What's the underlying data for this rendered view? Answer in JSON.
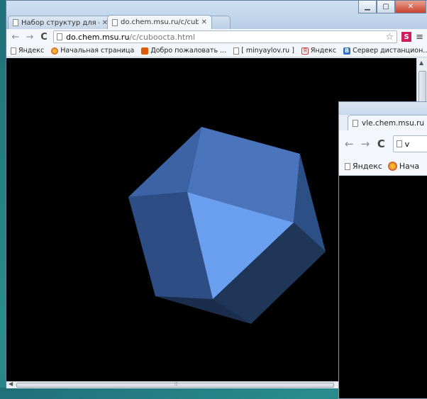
{
  "main_window": {
    "tabs": [
      {
        "label": "Набор структур для семи"
      },
      {
        "label": "do.chem.msu.ru/c/cuboc"
      }
    ],
    "address": {
      "host": "do.chem.msu.ru",
      "path": "/c/cuboocta.html"
    },
    "extension_label": "S",
    "bookmarks": [
      {
        "label": "Яндекс",
        "icon": "page-icon"
      },
      {
        "label": "Начальная страница",
        "icon": "firefox-icon"
      },
      {
        "label": "Добро пожаловать ...",
        "icon": "orange-square-icon"
      },
      {
        "label": "[ minyaylov.ru ]",
        "icon": "page-icon"
      },
      {
        "label": "Яндекс",
        "icon": "yandex-icon"
      },
      {
        "label": "Сервер дистанцион...",
        "icon": "blue-b-icon"
      }
    ],
    "bookmarks_overflow": "»",
    "polyhedron_colors": {
      "top": "#4a74bb",
      "left": "#3c63a5",
      "front_triangle": "#6a9ff0",
      "right_upper": "#2c4f86",
      "right_lower": "#1f3658",
      "left_lower": "#2d4d84",
      "bottom": "#1a2d4c"
    }
  },
  "second_window": {
    "tab_label": "vle.chem.msu.ru",
    "address_partial": "v",
    "bookmarks": [
      {
        "label": "Яндекс"
      },
      {
        "label": "Нача"
      }
    ]
  }
}
